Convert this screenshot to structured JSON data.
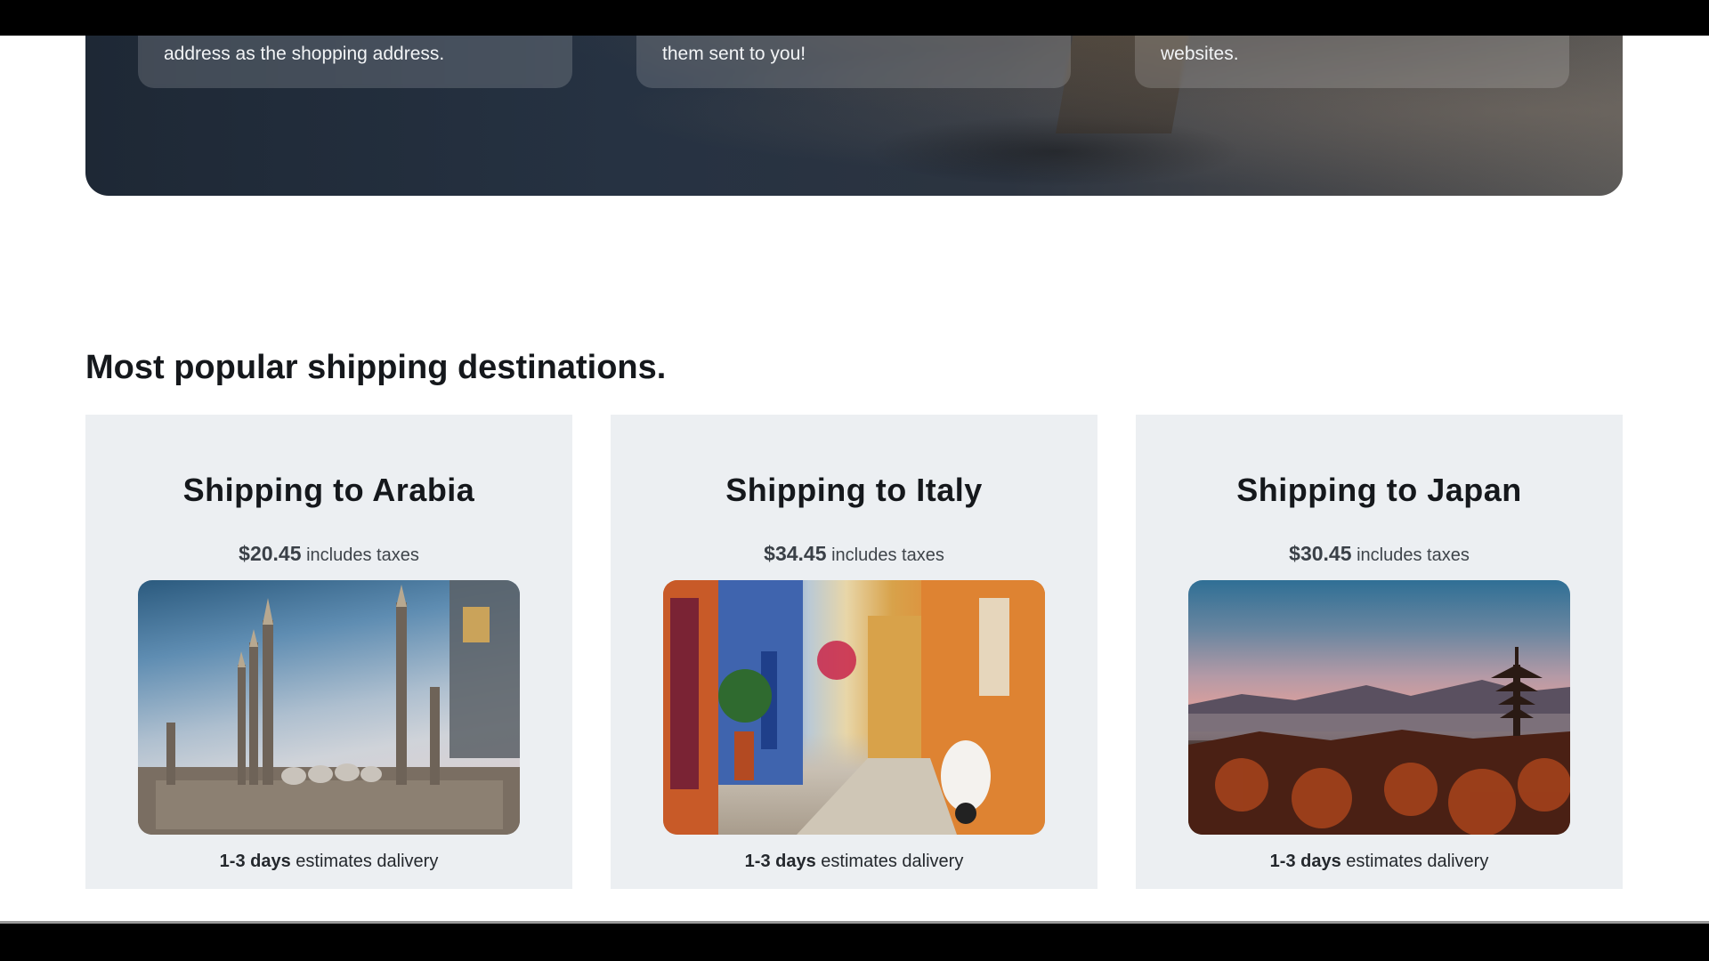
{
  "hero": {
    "features": [
      {
        "text": "address as the shopping address."
      },
      {
        "text": "them sent to you!"
      },
      {
        "text": "websites."
      }
    ]
  },
  "section": {
    "title": "Most popular shipping destinations."
  },
  "destinations": [
    {
      "title": "Shipping to Arabia",
      "price": "$20.45",
      "price_note": "includes taxes",
      "image_alt": "mosque",
      "days": "1-3 days",
      "delivery_note": "estimates dalivery"
    },
    {
      "title": "Shipping to Italy",
      "price": "$34.45",
      "price_note": "includes taxes",
      "image_alt": "italian street",
      "days": "1-3 days",
      "delivery_note": "estimates dalivery"
    },
    {
      "title": "Shipping to Japan",
      "price": "$30.45",
      "price_note": "includes taxes",
      "image_alt": "japanese pagoda",
      "days": "1-3 days",
      "delivery_note": "estimates dalivery"
    }
  ]
}
